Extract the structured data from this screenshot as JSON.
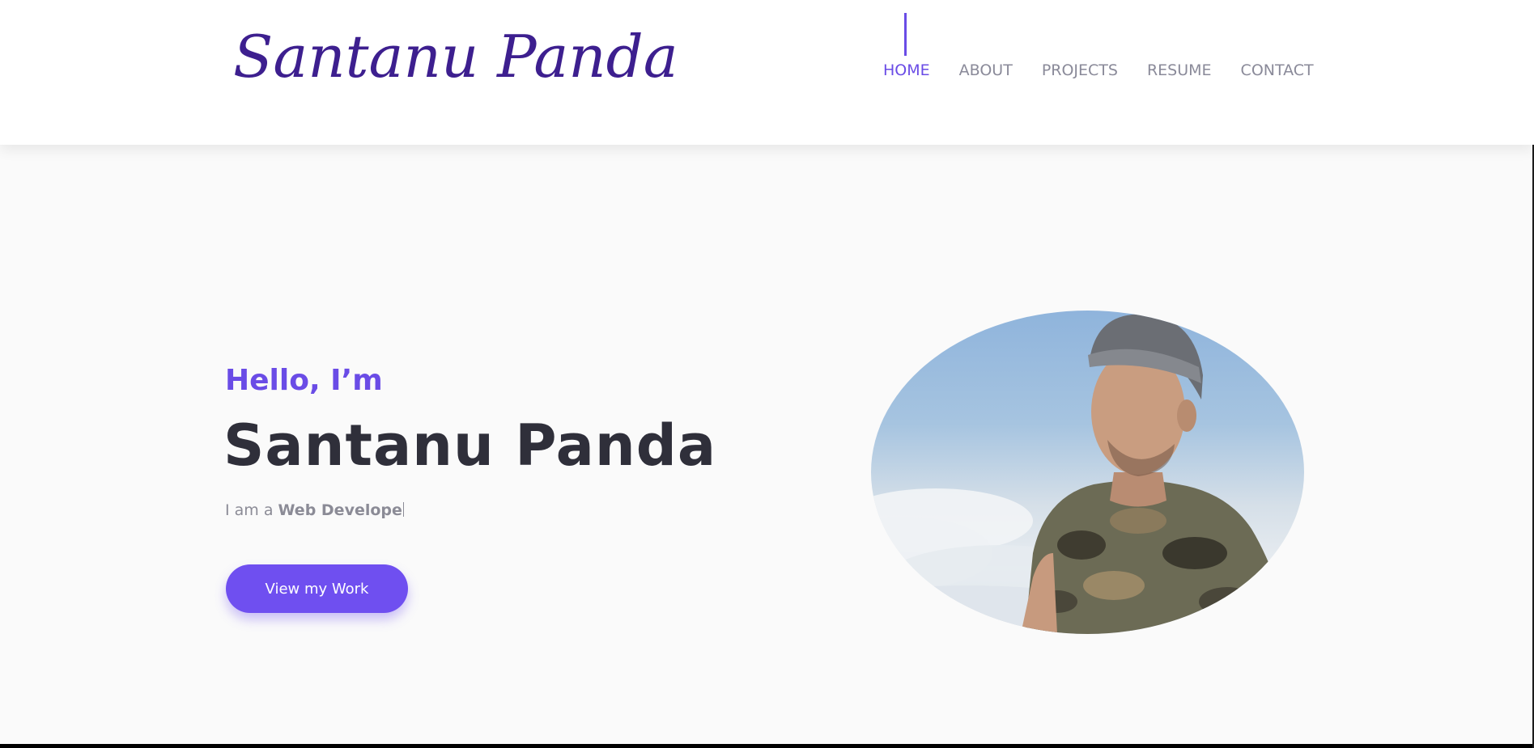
{
  "header": {
    "logo_text": "Santanu Panda",
    "nav": [
      {
        "label": "HOME",
        "active": true
      },
      {
        "label": "ABOUT",
        "active": false
      },
      {
        "label": "PROJECTS",
        "active": false
      },
      {
        "label": "RESUME",
        "active": false
      },
      {
        "label": "CONTACT",
        "active": false
      }
    ]
  },
  "hero": {
    "greeting": "Hello, I’m",
    "name": "Santanu Panda",
    "role_prefix": "I am a ",
    "role_typed": "Web Develope",
    "cta_label": "View my Work"
  },
  "colors": {
    "accent": "#6a4ce6",
    "button": "#6f4ff0",
    "heading": "#2f2f3a",
    "muted": "#8b8b96",
    "background": "#fafafa"
  },
  "icons": {
    "portrait": "profile-photo"
  }
}
